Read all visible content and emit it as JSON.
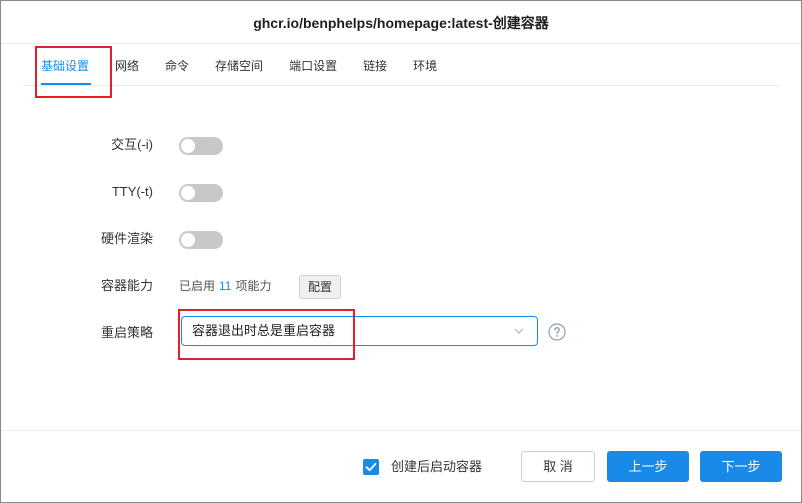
{
  "dialog": {
    "title": "ghcr.io/benphelps/homepage:latest-创建容器"
  },
  "tabs": [
    {
      "label": "基础设置",
      "active": true
    },
    {
      "label": "网络",
      "active": false
    },
    {
      "label": "命令",
      "active": false
    },
    {
      "label": "存储空间",
      "active": false
    },
    {
      "label": "端口设置",
      "active": false
    },
    {
      "label": "链接",
      "active": false
    },
    {
      "label": "环境",
      "active": false
    }
  ],
  "form": {
    "interactive": {
      "label": "交互(-i)",
      "enabled": false
    },
    "tty": {
      "label": "TTY(-t)",
      "enabled": false
    },
    "hw_render": {
      "label": "硬件渲染",
      "enabled": false
    },
    "capabilities": {
      "label": "容器能力",
      "prefix": "已启用",
      "count": "11",
      "suffix": "项能力",
      "button": "配置"
    },
    "restart_policy": {
      "label": "重启策略",
      "value": "容器退出时总是重启容器"
    }
  },
  "footer": {
    "start_after_create": {
      "label": "创建后启动容器",
      "checked": true
    },
    "cancel_label": "取 消",
    "prev_label": "上一步",
    "next_label": "下一步"
  },
  "colors": {
    "accent": "#1a8ae8",
    "toggle_off": "#c8c8c8",
    "highlight": "#e0202c"
  }
}
